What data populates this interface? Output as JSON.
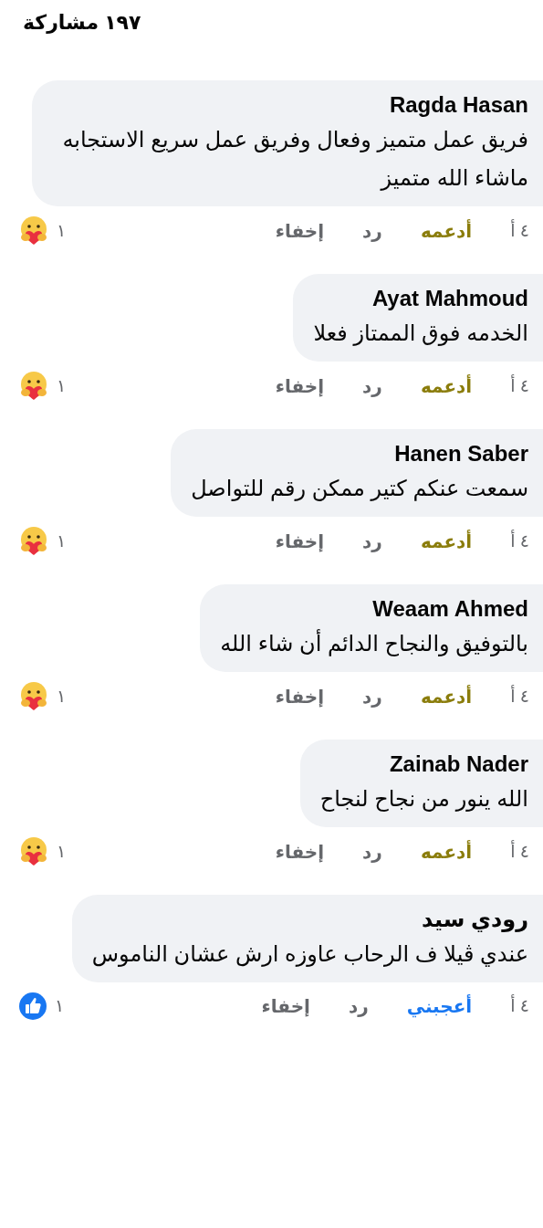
{
  "header": {
    "shares": "١٩٧ مشاركة"
  },
  "comments": [
    {
      "author": "Ragda Hasan",
      "text": "فريق عمل متميز وفعال وفريق عمل سريع الاستجابه ماشاء الله متميز",
      "time": "٤ أ",
      "reaction_label": "أدعمه",
      "kind": "care",
      "reply": "رد",
      "hide": "إخفاء",
      "reaction_count": "١"
    },
    {
      "author": "Ayat Mahmoud",
      "text": "الخدمه فوق الممتاز فعلا",
      "time": "٤ أ",
      "reaction_label": "أدعمه",
      "kind": "care",
      "reply": "رد",
      "hide": "إخفاء",
      "reaction_count": "١"
    },
    {
      "author": "Hanen Saber",
      "text": "سمعت عنكم كتير ممكن رقم للتواصل",
      "time": "٤ أ",
      "reaction_label": "أدعمه",
      "kind": "care",
      "reply": "رد",
      "hide": "إخفاء",
      "reaction_count": "١"
    },
    {
      "author": "Weaam Ahmed",
      "text": "بالتوفيق والنجاح الدائم أن شاء الله",
      "time": "٤ أ",
      "reaction_label": "أدعمه",
      "kind": "care",
      "reply": "رد",
      "hide": "إخفاء",
      "reaction_count": "١"
    },
    {
      "author": "Zainab Nader",
      "text": "الله ينور من نجاح لنجاح",
      "time": "٤ أ",
      "reaction_label": "أدعمه",
      "kind": "care",
      "reply": "رد",
      "hide": "إخفاء",
      "reaction_count": "١"
    },
    {
      "author": "رودي سيد",
      "text": "عندي ڤيلا ف الرحاب  عاوزه ارش عشان الناموس",
      "time": "٤ أ",
      "reaction_label": "أعجبني",
      "kind": "like",
      "reply": "رد",
      "hide": "إخفاء",
      "reaction_count": "١"
    }
  ]
}
